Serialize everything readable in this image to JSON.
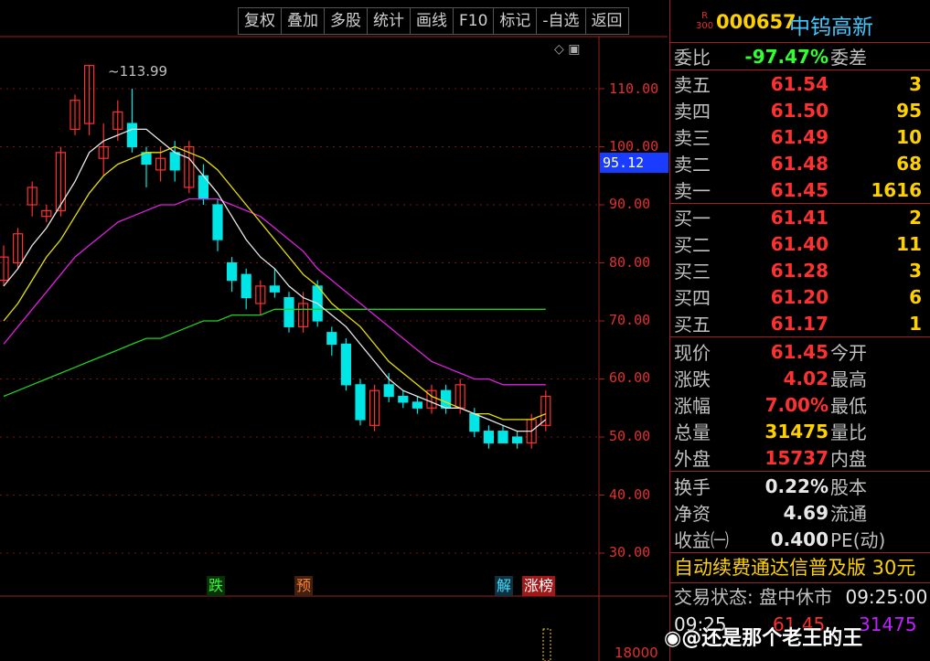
{
  "toolbar": {
    "items": [
      "复权",
      "叠加",
      "多股",
      "统计",
      "画线",
      "F10",
      "标记",
      "-自选",
      "返回"
    ]
  },
  "price_axis": [
    "110.00",
    "100.00",
    "90.00",
    "80.00",
    "70.00",
    "60.00",
    "50.00",
    "40.00",
    "30.00"
  ],
  "current_price_tag": "95.12",
  "high_marker": "113.99",
  "signals": {
    "die": "跌",
    "yu": "预",
    "jie": "解",
    "zhangbang": "涨榜"
  },
  "volume_axis_label": "18000",
  "stock": {
    "badge_top": "R",
    "badge_bottom": "300",
    "code": "000657",
    "name": "中钨高新"
  },
  "weibi": {
    "label": "委比",
    "value": "-97.47%",
    "label2": "委差"
  },
  "asks": [
    {
      "label": "卖五",
      "price": "61.54",
      "qty": "3"
    },
    {
      "label": "卖四",
      "price": "61.50",
      "qty": "95"
    },
    {
      "label": "卖三",
      "price": "61.49",
      "qty": "10"
    },
    {
      "label": "卖二",
      "price": "61.48",
      "qty": "68"
    },
    {
      "label": "卖一",
      "price": "61.45",
      "qty": "1616"
    }
  ],
  "bids": [
    {
      "label": "买一",
      "price": "61.41",
      "qty": "2"
    },
    {
      "label": "买二",
      "price": "61.40",
      "qty": "11"
    },
    {
      "label": "买三",
      "price": "61.28",
      "qty": "3"
    },
    {
      "label": "买四",
      "price": "61.20",
      "qty": "6"
    },
    {
      "label": "买五",
      "price": "61.17",
      "qty": "1"
    }
  ],
  "stats": [
    {
      "label": "现价",
      "value": "61.45",
      "label2": "今开"
    },
    {
      "label": "涨跌",
      "value": "4.02",
      "label2": "最高"
    },
    {
      "label": "涨幅",
      "value": "7.00%",
      "label2": "最低"
    },
    {
      "label": "总量",
      "value": "31475",
      "label2": "量比"
    },
    {
      "label": "外盘",
      "value": "15737",
      "label2": "内盘"
    }
  ],
  "stats2": [
    {
      "label": "换手",
      "value": "0.22%",
      "label2": "股本"
    },
    {
      "label": "净资",
      "value": "4.69",
      "label2": "流通"
    },
    {
      "label": "收益㈠",
      "value": "0.400",
      "label2": "PE(动)"
    }
  ],
  "ad_text": "自动续费通达信普及版  30元",
  "status": {
    "label": "交易状态:",
    "value": "盘中休市",
    "time": "09:25:00"
  },
  "tick": {
    "time": "09:25",
    "price": "61.45",
    "volume": "31475"
  },
  "watermark": "@还是那个老王的王",
  "colors": {
    "up": "#ff3030",
    "down": "#00e5e5",
    "ma5": "#e8e8e8",
    "ma10": "#e8e000",
    "ma20": "#e020e0",
    "ma60": "#20d020"
  },
  "chart_data": {
    "type": "candlestick",
    "y_range": [
      25,
      118
    ],
    "candles": [
      {
        "o": 77,
        "c": 81,
        "h": 83,
        "l": 76
      },
      {
        "o": 80,
        "c": 85,
        "h": 86,
        "l": 79
      },
      {
        "o": 90,
        "c": 93,
        "h": 94,
        "l": 88
      },
      {
        "o": 88,
        "c": 89,
        "h": 90,
        "l": 87
      },
      {
        "o": 89,
        "c": 99,
        "h": 100,
        "l": 88
      },
      {
        "o": 103,
        "c": 108,
        "h": 109,
        "l": 102
      },
      {
        "o": 104,
        "c": 113.99,
        "h": 113.99,
        "l": 102
      },
      {
        "o": 98,
        "c": 100,
        "h": 104,
        "l": 95
      },
      {
        "o": 103,
        "c": 106,
        "h": 108,
        "l": 101
      },
      {
        "o": 104,
        "c": 100,
        "h": 110,
        "l": 99
      },
      {
        "o": 99,
        "c": 97,
        "h": 100,
        "l": 93
      },
      {
        "o": 96,
        "c": 98,
        "h": 100,
        "l": 94
      },
      {
        "o": 99,
        "c": 96,
        "h": 101,
        "l": 94
      },
      {
        "o": 93,
        "c": 100,
        "h": 101,
        "l": 92
      },
      {
        "o": 95,
        "c": 91,
        "h": 97,
        "l": 90
      },
      {
        "o": 90,
        "c": 84,
        "h": 91,
        "l": 82
      },
      {
        "o": 80,
        "c": 77,
        "h": 81,
        "l": 75
      },
      {
        "o": 78,
        "c": 74,
        "h": 79,
        "l": 72
      },
      {
        "o": 73,
        "c": 76,
        "h": 77,
        "l": 71
      },
      {
        "o": 76,
        "c": 75,
        "h": 79,
        "l": 74
      },
      {
        "o": 74,
        "c": 69,
        "h": 75,
        "l": 68
      },
      {
        "o": 69,
        "c": 73,
        "h": 75,
        "l": 68
      },
      {
        "o": 76,
        "c": 70,
        "h": 77,
        "l": 69
      },
      {
        "o": 68,
        "c": 66,
        "h": 69,
        "l": 64
      },
      {
        "o": 66,
        "c": 59,
        "h": 67,
        "l": 58
      },
      {
        "o": 59,
        "c": 53,
        "h": 60,
        "l": 52
      },
      {
        "o": 52,
        "c": 58,
        "h": 59,
        "l": 51
      },
      {
        "o": 59,
        "c": 57,
        "h": 61,
        "l": 56
      },
      {
        "o": 57,
        "c": 56,
        "h": 58,
        "l": 55
      },
      {
        "o": 56,
        "c": 55,
        "h": 57,
        "l": 54
      },
      {
        "o": 55,
        "c": 58,
        "h": 59,
        "l": 54
      },
      {
        "o": 58,
        "c": 55,
        "h": 59,
        "l": 54
      },
      {
        "o": 55,
        "c": 59,
        "h": 60,
        "l": 54
      },
      {
        "o": 54,
        "c": 51,
        "h": 55,
        "l": 50
      },
      {
        "o": 51,
        "c": 49,
        "h": 52,
        "l": 48
      },
      {
        "o": 51,
        "c": 49,
        "h": 52,
        "l": 49
      },
      {
        "o": 50,
        "c": 49,
        "h": 51,
        "l": 48
      },
      {
        "o": 49,
        "c": 53,
        "h": 54,
        "l": 48
      },
      {
        "o": 52,
        "c": 57,
        "h": 58,
        "l": 51
      }
    ],
    "ma5": [
      76,
      79,
      83,
      86,
      90,
      94,
      99,
      101,
      102,
      103,
      103,
      101,
      99,
      98,
      95,
      92,
      88,
      84,
      81,
      79,
      76,
      74,
      73,
      71,
      69,
      66,
      63,
      60,
      58,
      57,
      56,
      55,
      55,
      54,
      53,
      52,
      51,
      51,
      53
    ],
    "ma10": [
      70,
      73,
      77,
      81,
      84,
      88,
      92,
      95,
      97,
      98,
      99,
      99,
      100,
      99,
      98,
      96,
      93,
      90,
      87,
      84,
      81,
      78,
      76,
      73,
      71,
      69,
      66,
      63,
      61,
      59,
      57,
      56,
      55,
      54,
      54,
      53,
      53,
      53,
      54
    ],
    "ma20": [
      66,
      69,
      72,
      75,
      78,
      81,
      83,
      85,
      87,
      88,
      89,
      90,
      90,
      91,
      91,
      91,
      90,
      89,
      88,
      86,
      84,
      82,
      79,
      77,
      75,
      73,
      71,
      69,
      67,
      65,
      63,
      62,
      61,
      60,
      60,
      59,
      59,
      59,
      59
    ],
    "ma60": [
      57,
      58,
      59,
      60,
      61,
      62,
      63,
      64,
      65,
      66,
      67,
      67,
      68,
      69,
      70,
      70,
      71,
      71,
      71,
      72,
      72,
      72,
      72,
      72,
      72,
      72,
      72,
      72,
      72,
      72,
      72,
      72,
      72,
      72,
      72,
      72,
      72,
      72,
      72
    ]
  }
}
